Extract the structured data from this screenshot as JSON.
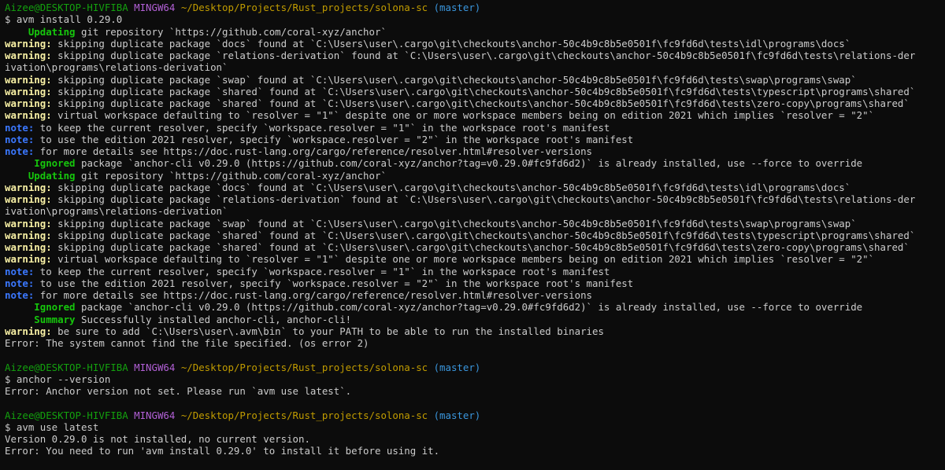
{
  "colors": {
    "background": "#0c0c0c",
    "text": "#cccccc",
    "user": "#13a10e",
    "host": "#b260d6",
    "path": "#c19c00",
    "branch": "#3a96dd",
    "warning": "#f9f1a5",
    "note": "#3b78ff",
    "status": "#16c60c"
  },
  "lines": [
    {
      "type": "prompt",
      "user": "Aizee@DESKTOP-HIVFIBA",
      "host": "MINGW64",
      "path": "~/Desktop/Projects/Rust_projects/solona-sc",
      "branch": "(master)"
    },
    {
      "type": "plain",
      "text": "$ avm install 0.29.0"
    },
    {
      "type": "status",
      "tag": "    Updating",
      "text": " git repository `https://github.com/coral-xyz/anchor`"
    },
    {
      "type": "warning",
      "tag": "warning:",
      "text": " skipping duplicate package `docs` found at `C:\\Users\\user\\.cargo\\git\\checkouts\\anchor-50c4b9c8b5e0501f\\fc9fd6d\\tests\\idl\\programs\\docs`"
    },
    {
      "type": "warning",
      "tag": "warning:",
      "text": " skipping duplicate package `relations-derivation` found at `C:\\Users\\user\\.cargo\\git\\checkouts\\anchor-50c4b9c8b5e0501f\\fc9fd6d\\tests\\relations-der"
    },
    {
      "type": "plain",
      "text": "ivation\\programs\\relations-derivation`"
    },
    {
      "type": "warning",
      "tag": "warning:",
      "text": " skipping duplicate package `swap` found at `C:\\Users\\user\\.cargo\\git\\checkouts\\anchor-50c4b9c8b5e0501f\\fc9fd6d\\tests\\swap\\programs\\swap`"
    },
    {
      "type": "warning",
      "tag": "warning:",
      "text": " skipping duplicate package `shared` found at `C:\\Users\\user\\.cargo\\git\\checkouts\\anchor-50c4b9c8b5e0501f\\fc9fd6d\\tests\\typescript\\programs\\shared`"
    },
    {
      "type": "warning",
      "tag": "warning:",
      "text": " skipping duplicate package `shared` found at `C:\\Users\\user\\.cargo\\git\\checkouts\\anchor-50c4b9c8b5e0501f\\fc9fd6d\\tests\\zero-copy\\programs\\shared`"
    },
    {
      "type": "warning",
      "tag": "warning:",
      "text": " virtual workspace defaulting to `resolver = \"1\"` despite one or more workspace members being on edition 2021 which implies `resolver = \"2\"`"
    },
    {
      "type": "note",
      "tag": "note:",
      "text": " to keep the current resolver, specify `workspace.resolver = \"1\"` in the workspace root's manifest"
    },
    {
      "type": "note",
      "tag": "note:",
      "text": " to use the edition 2021 resolver, specify `workspace.resolver = \"2\"` in the workspace root's manifest"
    },
    {
      "type": "note",
      "tag": "note:",
      "text": " for more details see https://doc.rust-lang.org/cargo/reference/resolver.html#resolver-versions"
    },
    {
      "type": "status",
      "tag": "     Ignored",
      "text": " package `anchor-cli v0.29.0 (https://github.com/coral-xyz/anchor?tag=v0.29.0#fc9fd6d2)` is already installed, use --force to override"
    },
    {
      "type": "status",
      "tag": "    Updating",
      "text": " git repository `https://github.com/coral-xyz/anchor`"
    },
    {
      "type": "warning",
      "tag": "warning:",
      "text": " skipping duplicate package `docs` found at `C:\\Users\\user\\.cargo\\git\\checkouts\\anchor-50c4b9c8b5e0501f\\fc9fd6d\\tests\\idl\\programs\\docs`"
    },
    {
      "type": "warning",
      "tag": "warning:",
      "text": " skipping duplicate package `relations-derivation` found at `C:\\Users\\user\\.cargo\\git\\checkouts\\anchor-50c4b9c8b5e0501f\\fc9fd6d\\tests\\relations-der"
    },
    {
      "type": "plain",
      "text": "ivation\\programs\\relations-derivation`"
    },
    {
      "type": "warning",
      "tag": "warning:",
      "text": " skipping duplicate package `swap` found at `C:\\Users\\user\\.cargo\\git\\checkouts\\anchor-50c4b9c8b5e0501f\\fc9fd6d\\tests\\swap\\programs\\swap`"
    },
    {
      "type": "warning",
      "tag": "warning:",
      "text": " skipping duplicate package `shared` found at `C:\\Users\\user\\.cargo\\git\\checkouts\\anchor-50c4b9c8b5e0501f\\fc9fd6d\\tests\\typescript\\programs\\shared`"
    },
    {
      "type": "warning",
      "tag": "warning:",
      "text": " skipping duplicate package `shared` found at `C:\\Users\\user\\.cargo\\git\\checkouts\\anchor-50c4b9c8b5e0501f\\fc9fd6d\\tests\\zero-copy\\programs\\shared`"
    },
    {
      "type": "warning",
      "tag": "warning:",
      "text": " virtual workspace defaulting to `resolver = \"1\"` despite one or more workspace members being on edition 2021 which implies `resolver = \"2\"`"
    },
    {
      "type": "note",
      "tag": "note:",
      "text": " to keep the current resolver, specify `workspace.resolver = \"1\"` in the workspace root's manifest"
    },
    {
      "type": "note",
      "tag": "note:",
      "text": " to use the edition 2021 resolver, specify `workspace.resolver = \"2\"` in the workspace root's manifest"
    },
    {
      "type": "note",
      "tag": "note:",
      "text": " for more details see https://doc.rust-lang.org/cargo/reference/resolver.html#resolver-versions"
    },
    {
      "type": "status",
      "tag": "     Ignored",
      "text": " package `anchor-cli v0.29.0 (https://github.com/coral-xyz/anchor?tag=v0.29.0#fc9fd6d2)` is already installed, use --force to override"
    },
    {
      "type": "status",
      "tag": "     Summary",
      "text": " Successfully installed anchor-cli, anchor-cli!"
    },
    {
      "type": "warning",
      "tag": "warning:",
      "text": " be sure to add `C:\\Users\\user\\.avm\\bin` to your PATH to be able to run the installed binaries"
    },
    {
      "type": "plain",
      "text": "Error: The system cannot find the file specified. (os error 2)"
    },
    {
      "type": "blank",
      "text": ""
    },
    {
      "type": "prompt",
      "user": "Aizee@DESKTOP-HIVFIBA",
      "host": "MINGW64",
      "path": "~/Desktop/Projects/Rust_projects/solona-sc",
      "branch": "(master)"
    },
    {
      "type": "plain",
      "text": "$ anchor --version"
    },
    {
      "type": "plain",
      "text": "Error: Anchor version not set. Please run `avm use latest`."
    },
    {
      "type": "blank",
      "text": ""
    },
    {
      "type": "prompt",
      "user": "Aizee@DESKTOP-HIVFIBA",
      "host": "MINGW64",
      "path": "~/Desktop/Projects/Rust_projects/solona-sc",
      "branch": "(master)"
    },
    {
      "type": "plain",
      "text": "$ avm use latest"
    },
    {
      "type": "plain",
      "text": "Version 0.29.0 is not installed, no current version."
    },
    {
      "type": "plain",
      "text": "Error: You need to run 'avm install 0.29.0' to install it before using it."
    }
  ]
}
